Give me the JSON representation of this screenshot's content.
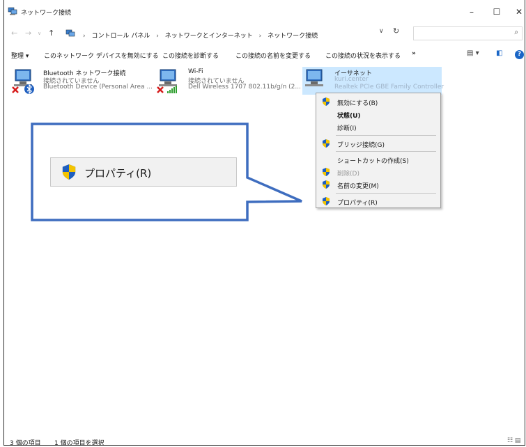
{
  "window": {
    "title": "ネットワーク接続",
    "minimize": "–",
    "maximize": "☐",
    "close": "✕"
  },
  "address": {
    "back": "←",
    "forward": "→",
    "recent": "∨",
    "up": "↑",
    "crumbs": [
      "コントロール パネル",
      "ネットワークとインターネット",
      "ネットワーク接続"
    ],
    "separator": "›",
    "dropdown": "∨",
    "refresh": "↻",
    "search_placeholder": "",
    "search_icon": "⌕"
  },
  "commands": {
    "organize": "整理 ▾",
    "disable": "このネットワーク デバイスを無効にする",
    "diagnose": "この接続を診断する",
    "rename": "この接続の名前を変更する",
    "status": "この接続の状況を表示する",
    "more": "»",
    "view_options": "▤ ▾",
    "preview_pane": "◧",
    "help": "?"
  },
  "adapters": [
    {
      "name": "Bluetooth ネットワーク接続",
      "status": "接続されていません",
      "device": "Bluetooth Device (Personal Area ..."
    },
    {
      "name": "Wi-Fi",
      "status": "接続されていません",
      "device": "Dell Wireless 1707 802.11b/g/n (2..."
    },
    {
      "name": "イーサネット",
      "status": "kuri.center",
      "device": "Realtek PCIe GBE Family Controller"
    }
  ],
  "context_menu": {
    "items": [
      {
        "label": "無効にする(B)"
      },
      {
        "label": "状態(U)"
      },
      {
        "label": "診断(I)"
      },
      {
        "label": "ブリッジ接続(G)"
      },
      {
        "label": "ショートカットの作成(S)"
      },
      {
        "label": "削除(D)"
      },
      {
        "label": "名前の変更(M)"
      },
      {
        "label": "プロパティ(R)"
      }
    ]
  },
  "callout": {
    "label": "プロパティ(R)"
  },
  "statusbar": {
    "item_count": "3 個の項目",
    "selected_count": "1 個の項目を選択",
    "view_icons": "☷ ▤"
  },
  "colors": {
    "selection": "#cce8ff",
    "callout_border": "#3e6dbf",
    "shield_blue": "#1f5fbf",
    "shield_yellow": "#f4c400",
    "error_red": "#d61b1b",
    "signal_green": "#2e9e2e"
  }
}
